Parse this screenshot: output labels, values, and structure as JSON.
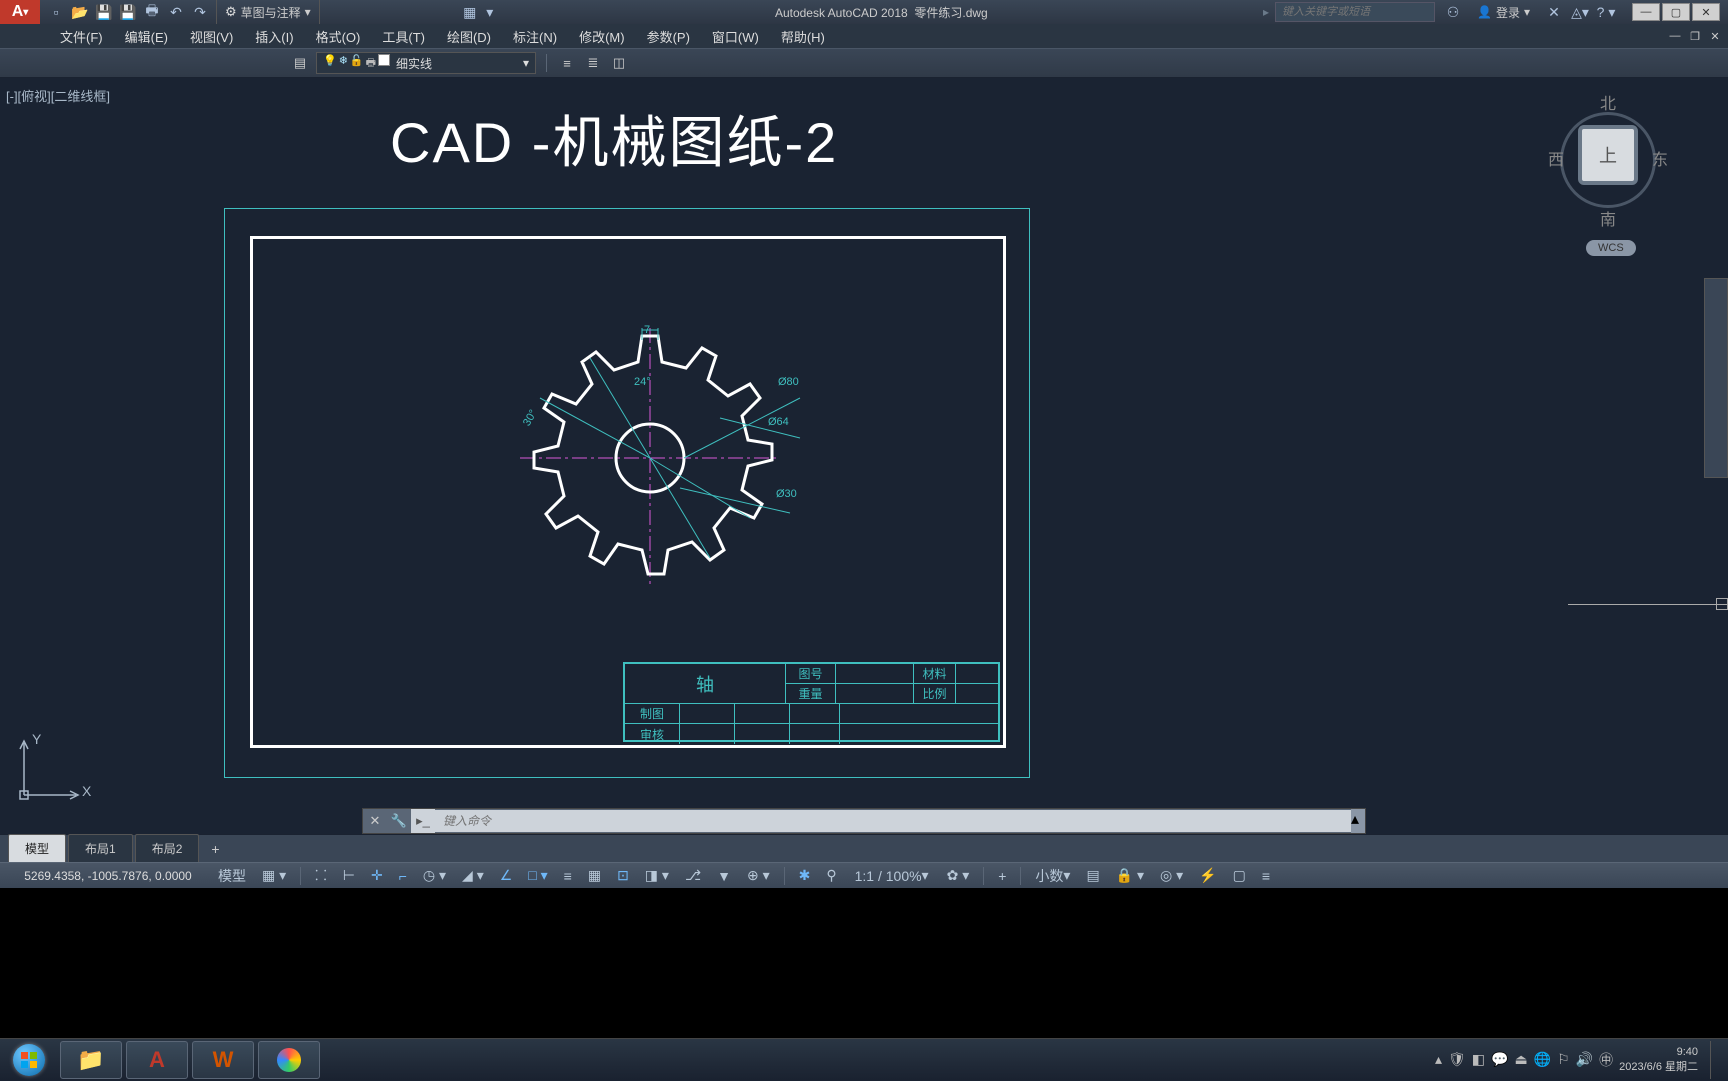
{
  "title": {
    "app": "Autodesk AutoCAD 2018",
    "doc": "零件练习.dwg",
    "workspace": "草图与注释",
    "search_placeholder": "键入关键字或短语",
    "login": "登录"
  },
  "menus": [
    "文件(F)",
    "编辑(E)",
    "视图(V)",
    "插入(I)",
    "格式(O)",
    "工具(T)",
    "绘图(D)",
    "标注(N)",
    "修改(M)",
    "参数(P)",
    "窗口(W)",
    "帮助(H)"
  ],
  "toolbar": {
    "layer_name": "细实线"
  },
  "viewport": {
    "label": "[-][俯视][二维线框]"
  },
  "drawing": {
    "title": "CAD -机械图纸-2",
    "dims": {
      "d7": "7",
      "a24": "24°",
      "a30": "30°",
      "d80": "Ø80",
      "d64": "Ø64",
      "d30": "Ø30"
    },
    "titleblock": {
      "part_name": "轴",
      "row1": {
        "c2": "图号",
        "c4": "材料"
      },
      "row2": {
        "c2": "重量",
        "c4": "比例"
      },
      "row3": {
        "c1": "制图"
      },
      "row4": {
        "c1": "审核"
      }
    }
  },
  "navcube": {
    "n": "北",
    "s": "南",
    "e": "东",
    "w": "西",
    "top": "上",
    "wcs": "WCS"
  },
  "cmdline": {
    "placeholder": "键入命令"
  },
  "layout_tabs": {
    "model": "模型",
    "layout1": "布局1",
    "layout2": "布局2"
  },
  "status": {
    "coords": "5269.4358, -1005.7876, 0.0000",
    "model": "模型",
    "scale": "1:1 / 100%",
    "units": "小数"
  },
  "taskbar": {
    "time": "9:40",
    "date": "2023/6/6 星期二"
  }
}
